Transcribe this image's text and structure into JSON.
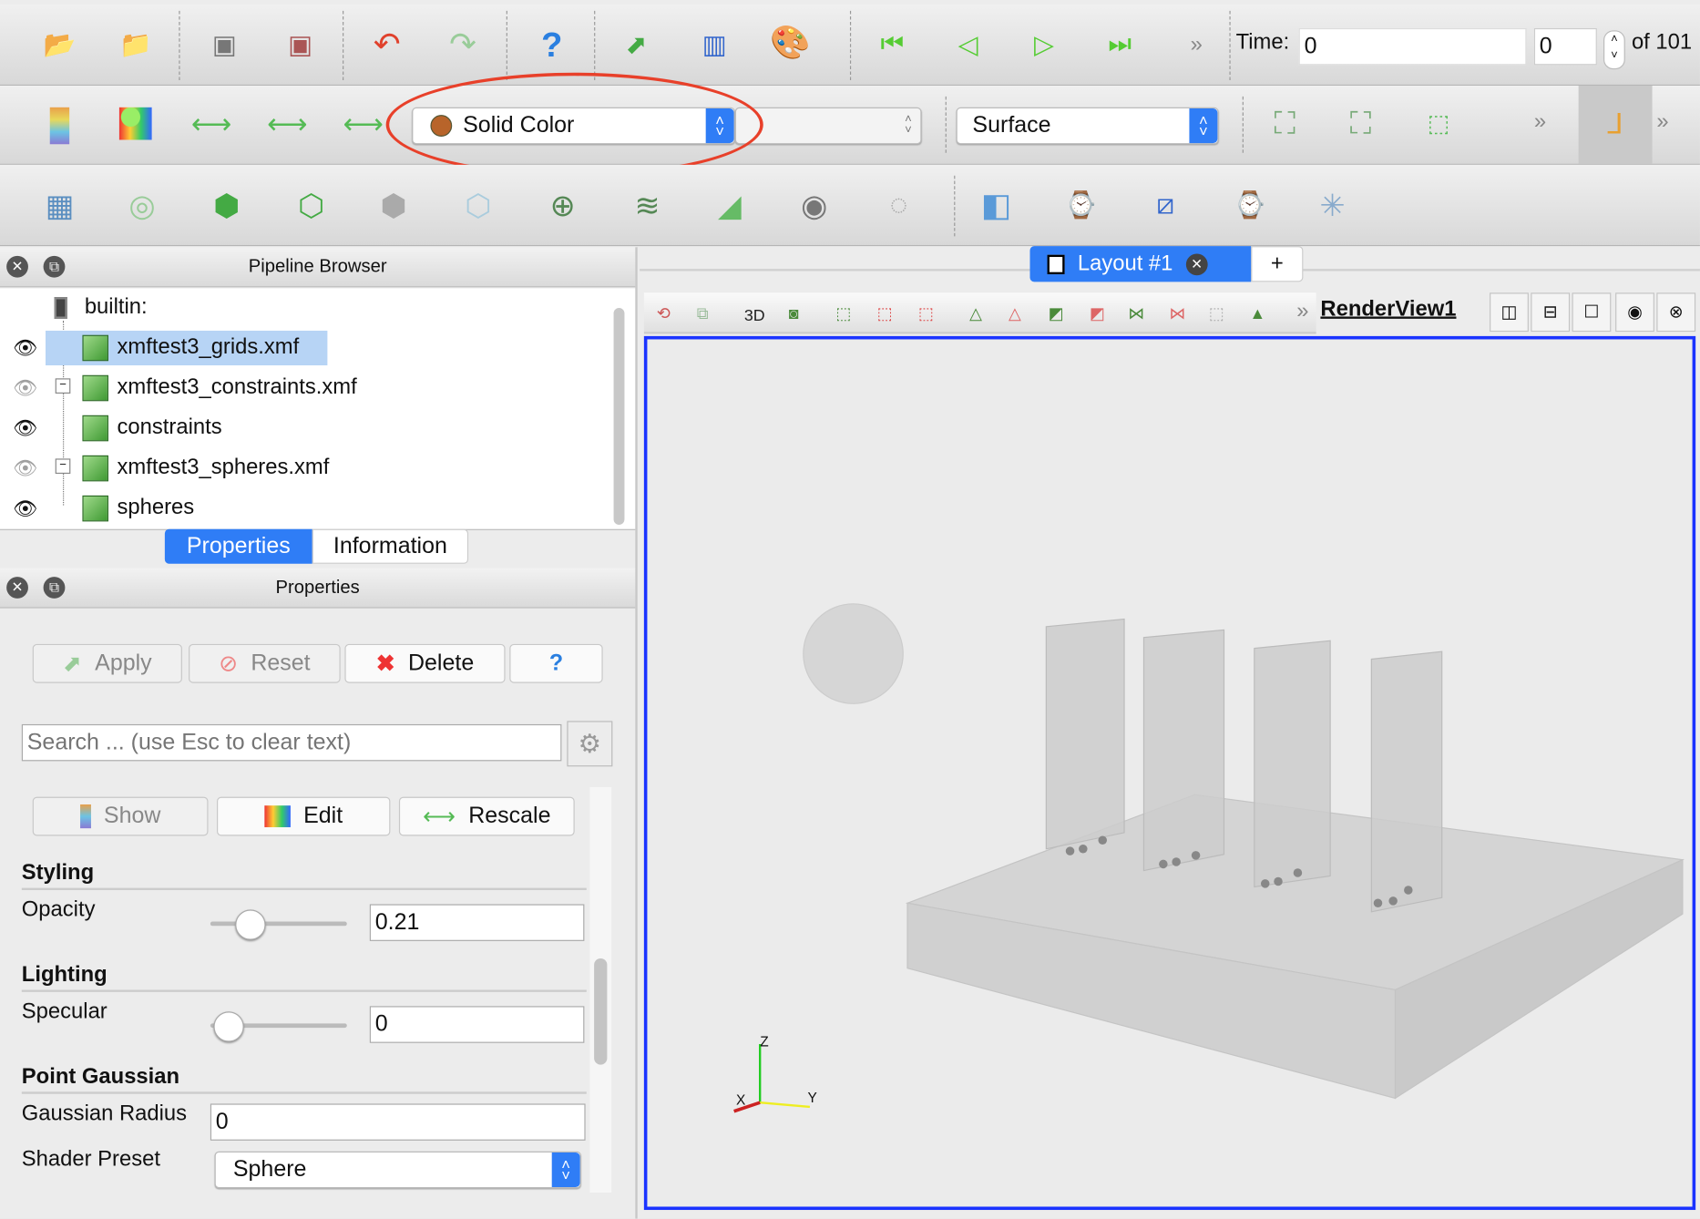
{
  "toolbar1": {
    "icons": [
      "open-icon",
      "load-state-icon",
      "connect-icon",
      "disconnect-icon",
      "undo-icon",
      "redo-icon",
      "help-icon",
      "save-data-icon",
      "save-screenshot-icon",
      "color-palette-icon",
      "first-frame-icon",
      "previous-frame-icon",
      "play-icon",
      "next-frame-icon"
    ],
    "more": "»",
    "time_label": "Time:",
    "time_value": "0",
    "timestep_value": "0",
    "of_label": "of 101"
  },
  "toolbar2": {
    "color_by": "Solid Color",
    "color_swatch": "#b8642a",
    "component": "",
    "representation": "Surface",
    "more": "»",
    "highlight_color": "#e8402a"
  },
  "pipeline": {
    "title": "Pipeline Browser",
    "root": "builtin:",
    "items": [
      {
        "label": "xmftest3_grids.xmf",
        "visible": true,
        "selected": true
      },
      {
        "label": "xmftest3_constraints.xmf",
        "visible": false,
        "expander": "−"
      },
      {
        "label": "constraints",
        "visible": true
      },
      {
        "label": "xmftest3_spheres.xmf",
        "visible": false,
        "expander": "−"
      },
      {
        "label": "spheres",
        "visible": true
      }
    ]
  },
  "tabs": {
    "properties": "Properties",
    "information": "Information"
  },
  "properties": {
    "title": "Properties",
    "apply": "Apply",
    "reset": "Reset",
    "delete": "Delete",
    "help": "?",
    "search_placeholder": "Search ... (use Esc to clear text)",
    "show": "Show",
    "edit": "Edit",
    "rescale": "Rescale",
    "styling": "Styling",
    "opacity_label": "Opacity",
    "opacity_value": "0.21",
    "opacity_fraction": 0.21,
    "lighting": "Lighting",
    "specular_label": "Specular",
    "specular_value": "0",
    "point_gaussian": "Point Gaussian",
    "gaussian_radius_label": "Gaussian Radius",
    "gaussian_radius_value": "0",
    "shader_preset_label": "Shader Preset",
    "shader_preset_value": "Sphere"
  },
  "layout": {
    "tab": "Layout #1",
    "add": "+"
  },
  "renderview": {
    "mode_3d": "3D",
    "more": "»",
    "name": "RenderView1",
    "axes": {
      "x": "X",
      "y": "Y",
      "z": "Z"
    },
    "border_color": "#1a33ff"
  }
}
